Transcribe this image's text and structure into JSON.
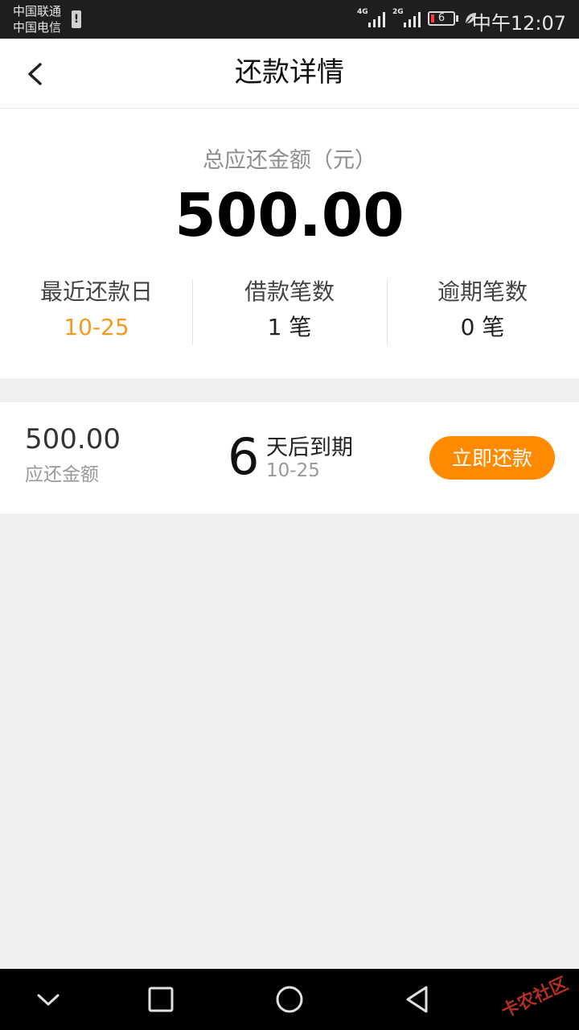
{
  "status_bar": {
    "carrier_1": "中国联通",
    "carrier_2": "中国电信",
    "net_1": "4G",
    "net_2": "2G",
    "battery_level": "6",
    "time": "中午12:07"
  },
  "header": {
    "title": "还款详情",
    "back_icon": "chevron-left-icon"
  },
  "summary": {
    "total_label": "总应还金额（元）",
    "total_amount": "500.00",
    "stats": [
      {
        "label": "最近还款日",
        "value": "10-25"
      },
      {
        "label": "借款笔数",
        "value": "1 笔"
      },
      {
        "label": "逾期笔数",
        "value": "0 笔"
      }
    ]
  },
  "repayment": {
    "amount": "500.00",
    "amount_label": "应还金额",
    "days": "6",
    "days_text": "天后到期",
    "due_date": "10-25",
    "pay_button": "立即还款"
  },
  "watermark": "卡农社区",
  "colors": {
    "accent_orange": "#ff8a00",
    "date_orange": "#f59a1e",
    "status_bar_bg": "#1e1e1e",
    "page_bg": "#f0f0f0"
  }
}
